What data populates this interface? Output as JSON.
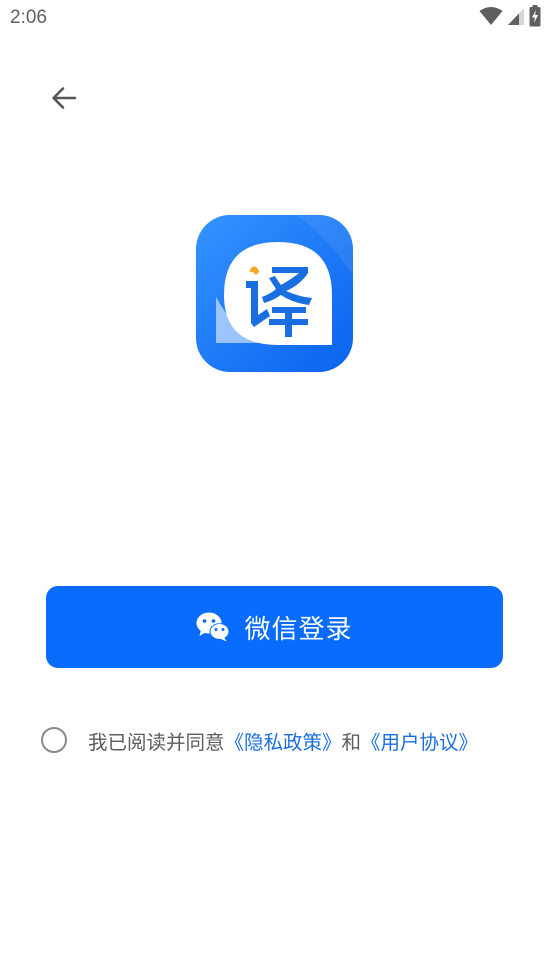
{
  "status_bar": {
    "time": "2:06",
    "icons": [
      "wifi-icon",
      "signal-icon",
      "battery-charging-icon"
    ]
  },
  "nav": {
    "back_icon": "arrow-left-icon"
  },
  "logo": {
    "glyph": "译",
    "colors": {
      "tile_top": "#2f8cff",
      "tile_bottom": "#0a66f0",
      "glyph": "#1a6fe0",
      "accent": "#f5a623"
    }
  },
  "login": {
    "label": "微信登录",
    "icon": "wechat-icon",
    "color": "#0a6cff"
  },
  "agreement": {
    "checked": false,
    "prefix": "我已阅读并同意",
    "privacy_link": "《隐私政策》",
    "conjunction": "和",
    "terms_link": "《用户协议》",
    "link_color": "#1a6fe0"
  }
}
